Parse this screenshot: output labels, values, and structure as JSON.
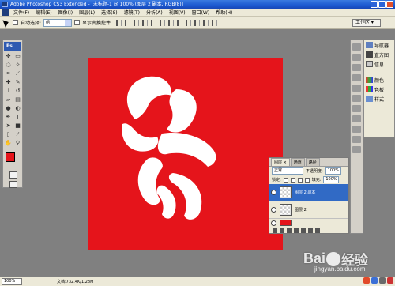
{
  "title_bar": {
    "title": "Adobe Photoshop CS3 Extended - [未标题-1 @ 100% (图层 2 副本, RGB/8)]"
  },
  "menu": [
    "文件(F)",
    "编辑(E)",
    "图像(I)",
    "图层(L)",
    "选择(S)",
    "滤镜(T)",
    "分析(A)",
    "视图(V)",
    "窗口(W)",
    "帮助(H)"
  ],
  "options_bar": {
    "auto_select_label": "自动选择:",
    "auto_select_value": "组",
    "show_transform_label": "显示变换控件",
    "workspace_label": "工作区 ▾"
  },
  "toolbox": {
    "logo": "Ps",
    "foreground_color": "#e5141b",
    "background_color": "#ffffff"
  },
  "canvas": {
    "fill_color": "#e5141b",
    "shape_color": "#ffffff"
  },
  "right_panel": {
    "items": [
      {
        "label": "导航器",
        "icon": "navigator-icon"
      },
      {
        "label": "直方图",
        "icon": "histogram-icon"
      },
      {
        "label": "信息",
        "icon": "info-icon"
      },
      {
        "label": "颜色",
        "icon": "color-icon"
      },
      {
        "label": "色板",
        "icon": "swatches-icon"
      },
      {
        "label": "样式",
        "icon": "styles-icon"
      }
    ]
  },
  "layers_panel": {
    "tabs": [
      "图层 ×",
      "通道",
      "路径"
    ],
    "blend_mode": "正常",
    "opacity_label": "不透明度:",
    "opacity_value": "100%",
    "lock_label": "锁定:",
    "fill_label": "填充:",
    "fill_value": "100%",
    "layers": [
      {
        "name": "图层 2 副本",
        "selected": true
      },
      {
        "name": "图层 2",
        "selected": false
      },
      {
        "name": "",
        "selected": false
      }
    ]
  },
  "status_bar": {
    "zoom": "100%",
    "doc_info": "文档:732.4K/1.28M"
  },
  "watermark": {
    "brand_left": "Bai",
    "brand_right": "经验",
    "url": "jingyan.baidu.com"
  }
}
